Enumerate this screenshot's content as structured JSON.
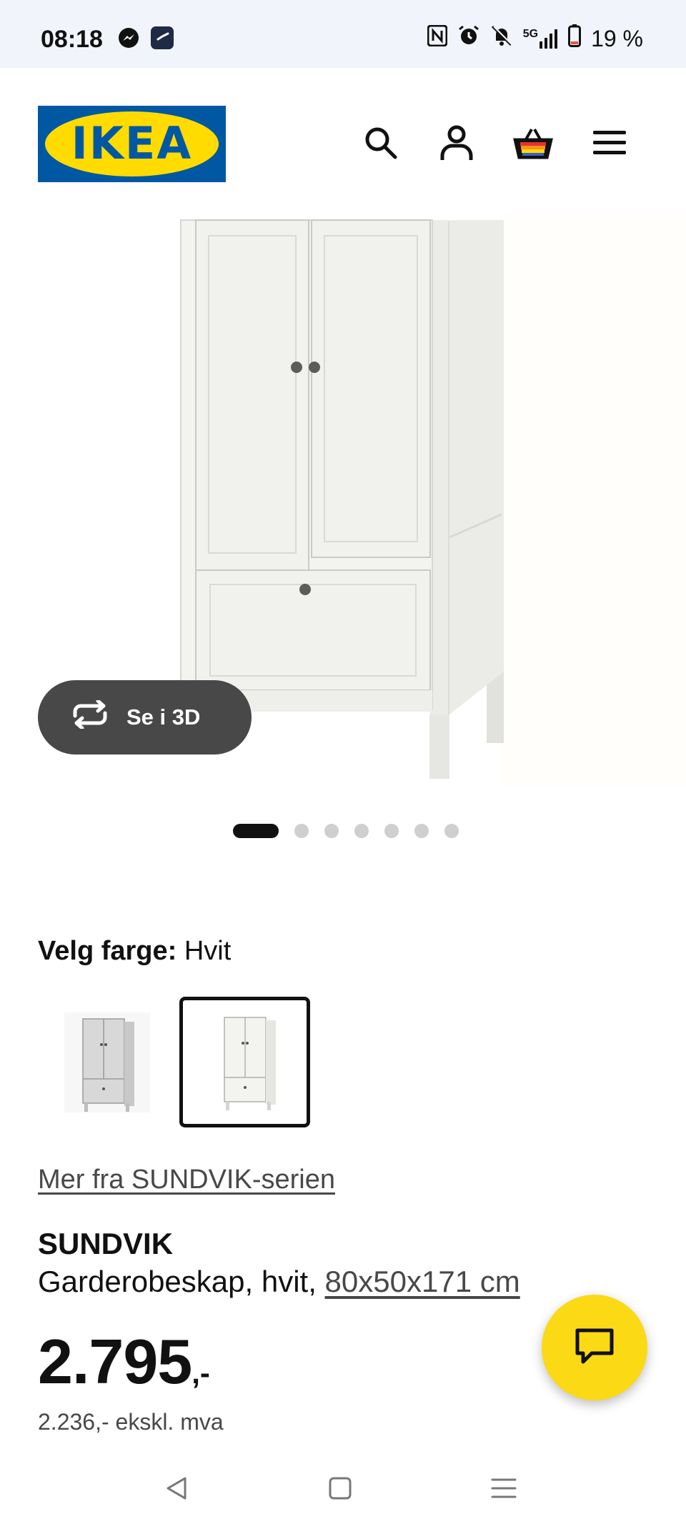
{
  "status_bar": {
    "time": "08:18",
    "icons_left": [
      "messenger-icon",
      "clock-app-icon"
    ],
    "icons_right": [
      "nfc-icon",
      "alarm-icon",
      "mute-icon",
      "signal-5g-icon",
      "battery-icon"
    ],
    "network": "5G",
    "battery": "19 %"
  },
  "header": {
    "logo_text": "IKEA",
    "icons": [
      "search-icon",
      "account-icon",
      "cart-icon",
      "menu-icon"
    ]
  },
  "gallery": {
    "view_3d_label": "Se i 3D",
    "page_count": 7,
    "active_index": 0
  },
  "color_selector": {
    "label": "Velg farge:",
    "value": "Hvit",
    "options": [
      "Grå",
      "Hvit"
    ],
    "selected_index": 1
  },
  "series_link": "Mer fra SUNDVIK-serien",
  "product": {
    "name": "SUNDVIK",
    "description": "Garderobeskap, hvit,",
    "dimensions": "80x50x171 cm",
    "price_main": "2.795",
    "price_suffix": ",-",
    "price_ex_vat": "2.236,- ekskl. mva"
  },
  "colors": {
    "ikea_blue": "#0058a3",
    "ikea_yellow": "#ffdb00",
    "chat_yellow": "#fbd914",
    "pill_dark": "#484848"
  }
}
